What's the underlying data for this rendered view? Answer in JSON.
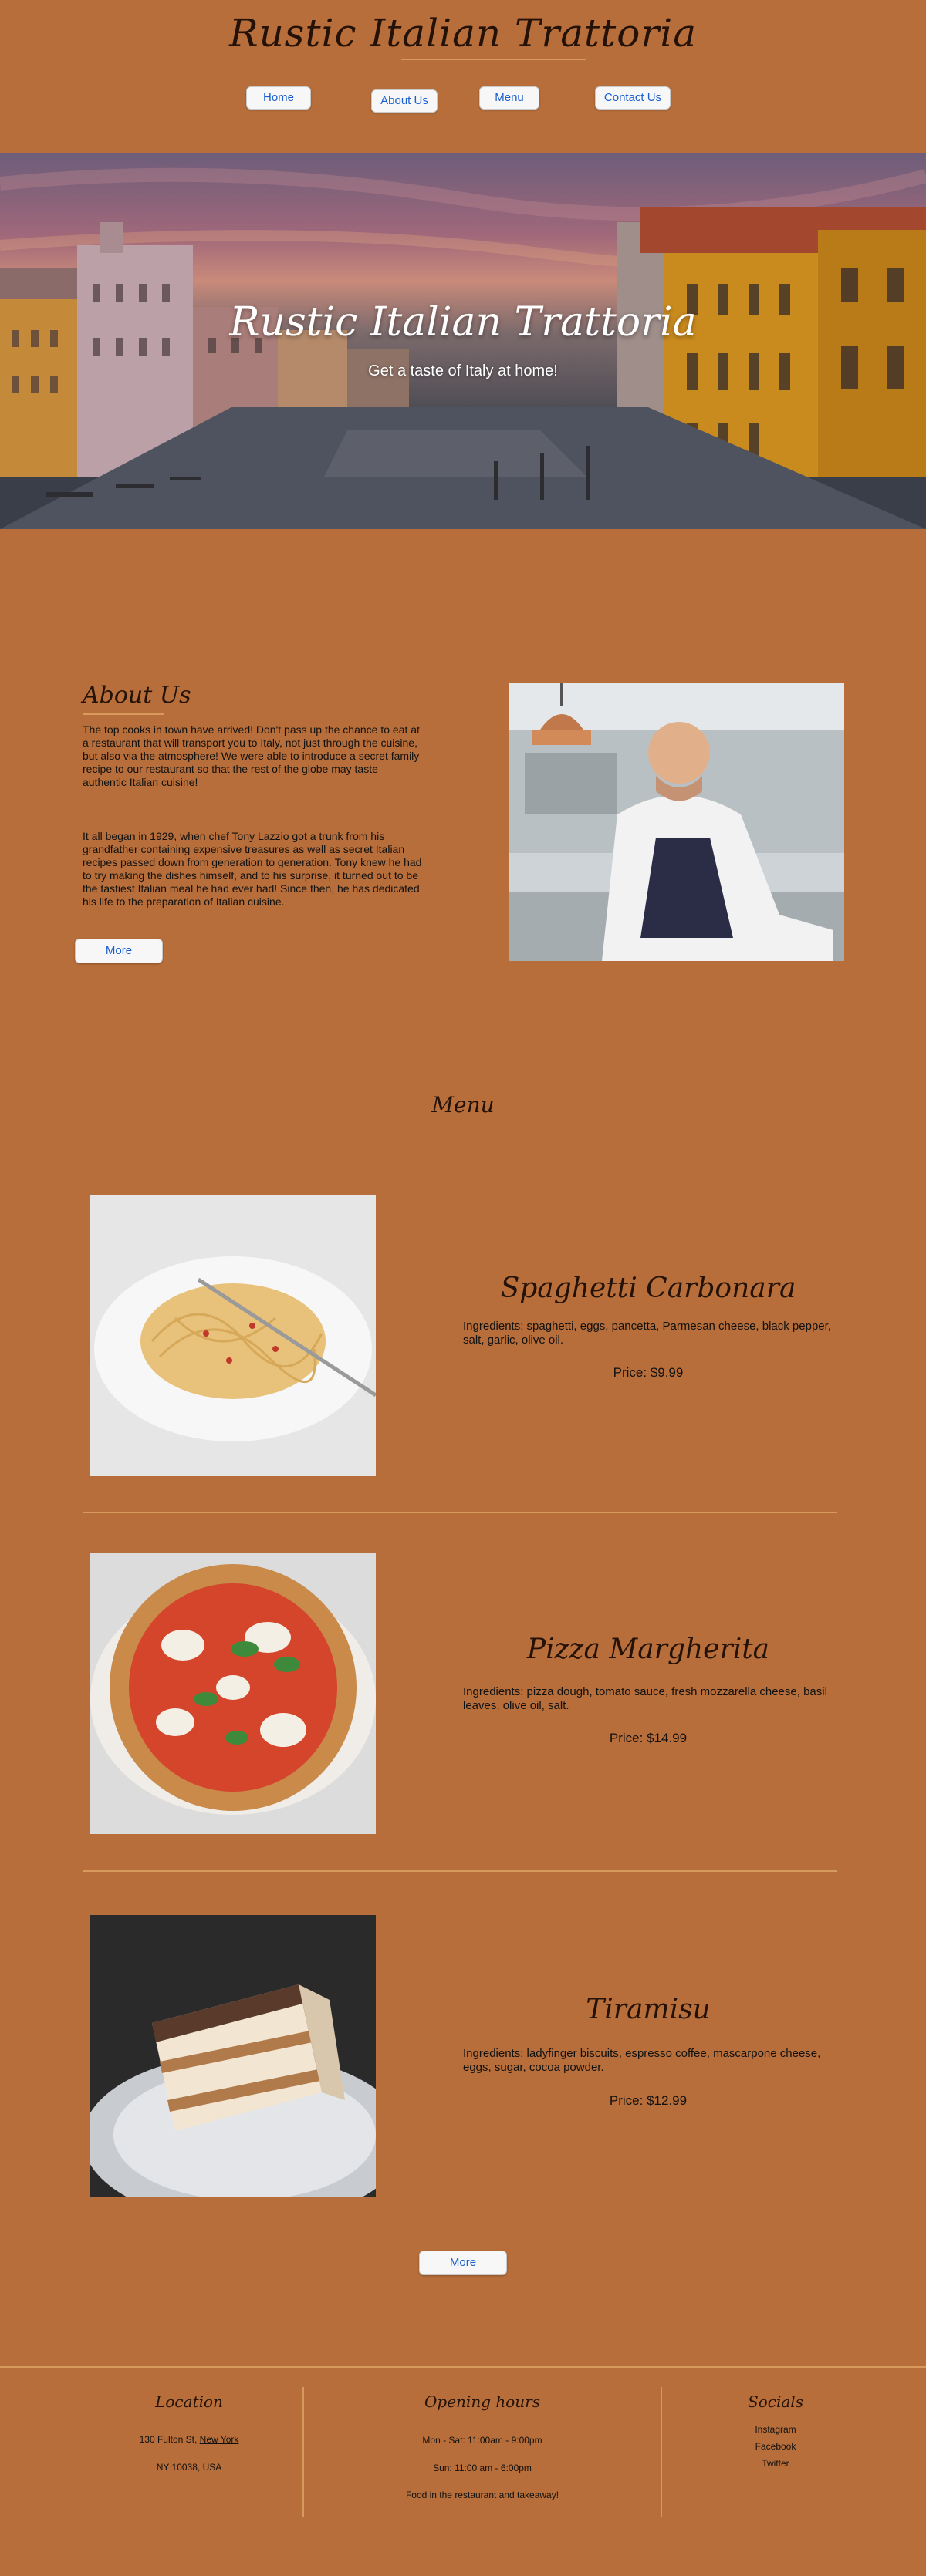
{
  "header": {
    "title": "Rustic Italian Trattoria",
    "nav": {
      "home": "Home",
      "about": "About Us",
      "menu": "Menu",
      "contact": "Contact Us"
    }
  },
  "hero": {
    "title": "Rustic Italian Trattoria",
    "subtitle": "Get a taste of Italy at home!"
  },
  "about": {
    "title": "About Us",
    "paragraph1": "The top cooks in town have arrived! Don't pass up the chance to eat at a restaurant that will transport you to Italy, not just through the cuisine, but also via the atmosphere! We were able to introduce a secret family recipe to our restaurant so that the rest of the globe may taste authentic Italian cuisine!",
    "paragraph2": "It all began in 1929, when chef Tony Lazzio got a trunk from his grandfather containing expensive treasures as well as secret Italian recipes passed down from generation to generation. Tony knew he had to try making the dishes himself, and to his surprise, it turned out to be the tastiest Italian meal he had ever had! Since then, he has dedicated his life to the preparation of Italian cuisine.",
    "more_label": "More"
  },
  "menu": {
    "title": "Menu",
    "items": [
      {
        "name": "Spaghetti Carbonara",
        "ingredients": "Ingredients: spaghetti, eggs, pancetta, Parmesan cheese, black pepper, salt, garlic, olive oil.",
        "price": "Price: $9.99"
      },
      {
        "name": "Pizza Margherita",
        "ingredients": "Ingredients: pizza dough, tomato sauce, fresh mozzarella cheese, basil leaves, olive oil, salt.",
        "price": "Price: $14.99"
      },
      {
        "name": "Tiramisu",
        "ingredients": "Ingredients: ladyfinger biscuits, espresso coffee, mascarpone cheese, eggs, sugar, cocoa powder.",
        "price": "Price: $12.99"
      }
    ],
    "more_label": "More"
  },
  "footer": {
    "location": {
      "title": "Location",
      "line1": "130 Fulton St,",
      "line1b": "New York",
      "line2": "NY 10038, USA"
    },
    "hours": {
      "title": "Opening hours",
      "line1": "Mon - Sat: 11:00am - 9:00pm",
      "line2": "Sun: 11:00 am - 6:00pm",
      "line3": "Food in the restaurant and takeaway!"
    },
    "socials": {
      "title": "Socials",
      "links": [
        "Instagram",
        "Facebook",
        "Twitter"
      ]
    }
  },
  "colors": {
    "background": "#b76e3a",
    "accent_line": "#d89a5c",
    "link": "#1a5fcf",
    "heading": "#241208"
  }
}
